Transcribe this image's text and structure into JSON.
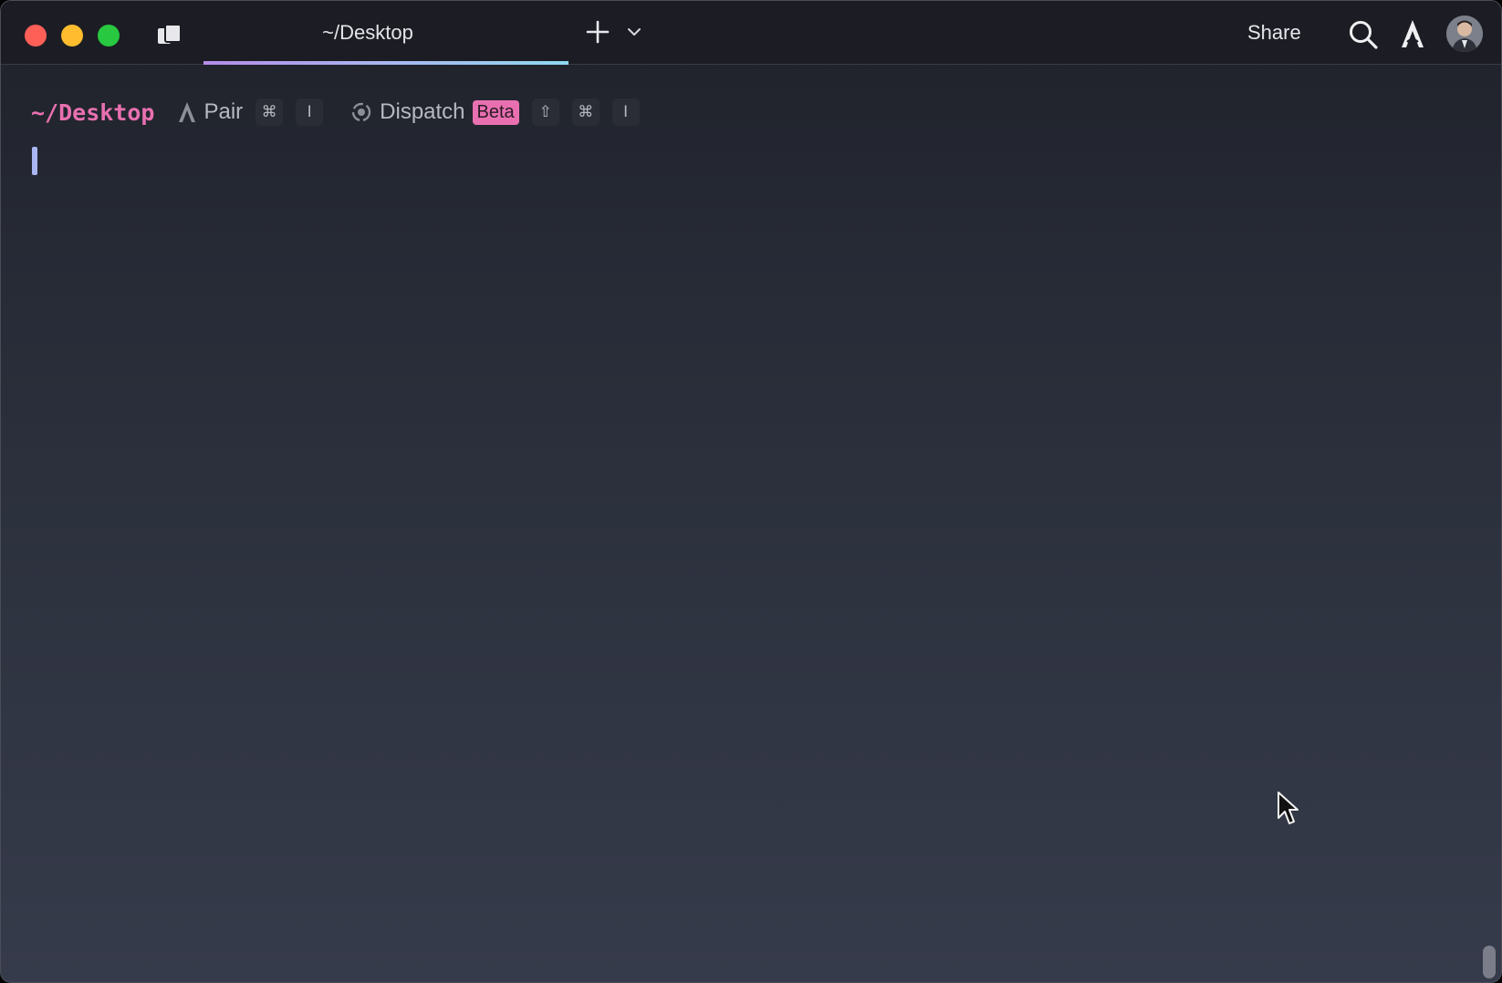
{
  "window": {
    "tab": {
      "label": "~/Desktop"
    },
    "share_label": "Share",
    "icons": {
      "panel": "tab-panel-icon",
      "new_tab": "plus-icon",
      "tab_menu": "chevron-down-icon",
      "search": "search-icon",
      "warp": "warp-logo-icon",
      "avatar": "user-avatar"
    }
  },
  "prompt": {
    "cwd": "~/Desktop",
    "pair": {
      "label": "Pair",
      "keys": [
        "⌘",
        "I"
      ]
    },
    "dispatch": {
      "label": "Dispatch",
      "badge": "Beta",
      "keys": [
        "⇧",
        "⌘",
        "I"
      ]
    }
  },
  "colors": {
    "accent_pink": "#e870b0",
    "cursor": "#aab6f2",
    "tab_gradient_start": "#b48de8",
    "tab_gradient_end": "#8fd8f0"
  }
}
